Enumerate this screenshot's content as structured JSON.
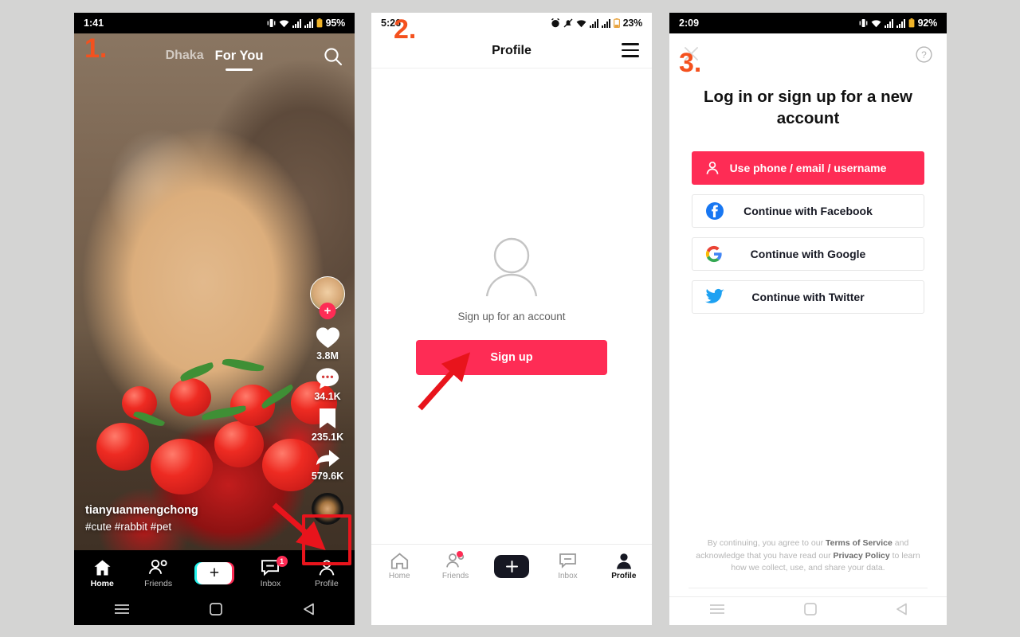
{
  "page": {
    "background_color": "#d4d4d3",
    "accent_color": "#fe2c55",
    "marker_color": "#f4511e"
  },
  "phone1": {
    "marker": "1.",
    "status_bar": {
      "time": "1:41",
      "battery": "95%"
    },
    "header": {
      "city_tab": "Dhaka",
      "foryou_tab": "For You",
      "search_icon": "search-icon"
    },
    "rail": {
      "likes": "3.8M",
      "comments": "34.1K",
      "bookmarks": "235.1K",
      "shares": "579.6K"
    },
    "caption": {
      "username": "tianyuanmengchong",
      "hashtags": "#cute #rabbit #pet"
    },
    "tabbar": [
      {
        "label": "Home",
        "icon": "home-icon",
        "active": true,
        "badge": ""
      },
      {
        "label": "Friends",
        "icon": "friends-icon",
        "active": false,
        "badge": ""
      },
      {
        "label": "",
        "icon": "create-icon",
        "active": false,
        "badge": ""
      },
      {
        "label": "Inbox",
        "icon": "inbox-icon",
        "active": false,
        "badge": "1"
      },
      {
        "label": "Profile",
        "icon": "profile-icon",
        "active": false,
        "badge": ""
      }
    ],
    "android_nav": [
      "menu-icon",
      "home-square-icon",
      "back-triangle-icon"
    ]
  },
  "phone2": {
    "marker": "2.",
    "status_bar": {
      "time": "5:26",
      "battery": "23%"
    },
    "header": {
      "title": "Profile",
      "menu_icon": "hamburger-icon"
    },
    "empty_state": {
      "avatar_icon": "person-placeholder-icon",
      "subtitle": "Sign up for an account",
      "signup_button": "Sign up"
    },
    "tabbar": [
      {
        "label": "Home",
        "icon": "home-icon",
        "active": false,
        "dot": false
      },
      {
        "label": "Friends",
        "icon": "friends-icon",
        "active": false,
        "dot": true
      },
      {
        "label": "",
        "icon": "create-icon",
        "active": false,
        "dot": false
      },
      {
        "label": "Inbox",
        "icon": "inbox-icon",
        "active": false,
        "dot": false
      },
      {
        "label": "Profile",
        "icon": "profile-icon",
        "active": true,
        "dot": false
      }
    ]
  },
  "phone3": {
    "marker": "3.",
    "status_bar": {
      "time": "2:09",
      "battery": "92%"
    },
    "top": {
      "close_icon": "close-icon",
      "help_icon": "help-circle-icon"
    },
    "title": "Log in or sign up for a new account",
    "buttons": [
      {
        "label": "Use phone / email / username",
        "icon": "person-icon",
        "primary": true
      },
      {
        "label": "Continue with Facebook",
        "icon": "facebook-icon",
        "primary": false
      },
      {
        "label": "Continue with Google",
        "icon": "google-icon",
        "primary": false
      },
      {
        "label": "Continue with Twitter",
        "icon": "twitter-icon",
        "primary": false
      }
    ],
    "legal": {
      "line1_pre": "By continuing, you agree to our ",
      "terms": "Terms of Service",
      "line1_post": " and",
      "line2_pre": "acknowledge that you have read our ",
      "privacy": "Privacy Policy",
      "line2_post": " to",
      "line3": "learn how we collect, use, and share your data."
    },
    "android_nav": [
      "menu-icon",
      "home-square-icon",
      "back-triangle-icon"
    ]
  }
}
